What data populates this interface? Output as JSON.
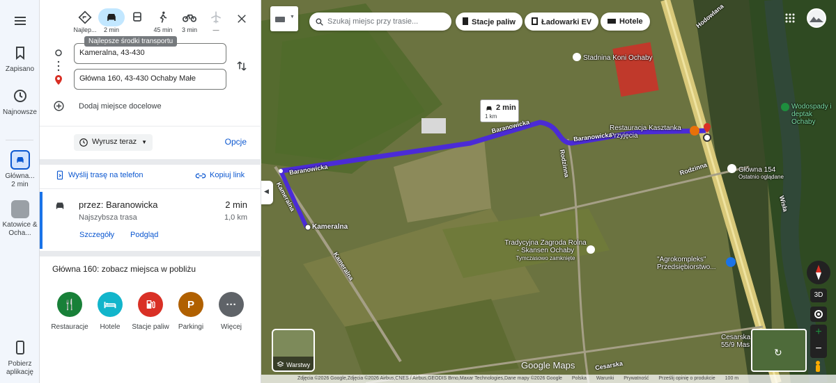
{
  "rail": {
    "saved": "Zapisano",
    "recent": "Najnowsze",
    "active_route": "Główna...",
    "active_route_time": "2 min",
    "other_route": "Katowice & Ocha...",
    "get_app": "Pobierz aplikację"
  },
  "modes": {
    "best": "Najlep...",
    "car": "2 min",
    "transit": "",
    "walk": "45 min",
    "bike": "3 min",
    "flight": "—",
    "tooltip": "Najlepsze środki transportu"
  },
  "directions": {
    "origin": "Kameralna, 43-430",
    "destination": "Główna 160, 43-430 Ochaby Małe",
    "add_destination": "Dodaj miejsce docelowe",
    "depart": "Wyrusz teraz",
    "options": "Opcje",
    "send_to_phone": "Wyślij trasę na telefon",
    "copy_link": "Kopiuj link"
  },
  "route": {
    "via": "przez: Baranowicka",
    "time": "2 min",
    "subtitle": "Najszybsza trasa",
    "distance": "1,0 km",
    "details": "Szczegóły",
    "preview": "Podgląd"
  },
  "nearby": {
    "title": "Główna 160: zobacz miejsca w pobliżu",
    "categories": [
      {
        "label": "Restauracje",
        "icon": "fork-knife-icon",
        "color": "#188038"
      },
      {
        "label": "Hotele",
        "icon": "bed-icon",
        "color": "#12b5cb"
      },
      {
        "label": "Stacje paliw",
        "icon": "fuel-icon",
        "color": "#d93025"
      },
      {
        "label": "Parkingi",
        "icon": "parking-icon",
        "color": "#b06000"
      },
      {
        "label": "Więcej",
        "icon": "more-icon",
        "color": "#5f6368"
      }
    ]
  },
  "map": {
    "search_placeholder": "Szukaj miejsc przy trasie...",
    "chips": [
      "Stacje paliw",
      "Ładowarki EV",
      "Hotele"
    ],
    "route_bubble_time": "2 min",
    "route_bubble_dist": "1 km",
    "labels": {
      "stadnina": "Stadnina Koni Ochaby",
      "wodospady": "Wodospady i deptak Ochaby",
      "restauracja": "Restauracja Kasztanka Przyjęcia",
      "glowna154": "Główna 154",
      "glowna154_sub": "Ostatnio oglądane",
      "tradycyjna": "Tradycyjna Zagroda Rolna - Skansen Ochaby",
      "tradycyjna_sub": "Tymczasowo zamknięte",
      "agrokompleks": "\"Agrokompleks\" Przedsiębiorstwo...",
      "kameralna": "Kameralna",
      "cesarska": "Cesarska",
      "cesarska_addr": "Cesarska 55/9 Mas",
      "hodowlana": "Hodowlana",
      "wisla": "Wisła",
      "rodzinna": "Rodzinna"
    },
    "layers": "Warstwy",
    "view_3d": "3D",
    "attribution": [
      "Zdjęcia ©2026 Google,Zdjęcia ©2026 Airbus,CNES / Airbus,GEODIS Brno,Maxar Technologies,Dane mapy ©2026 Google",
      "Polska",
      "Warunki",
      "Prywatność",
      "Prześlij opinię o produkcie",
      "100 m"
    ],
    "brand": "Google Maps"
  }
}
